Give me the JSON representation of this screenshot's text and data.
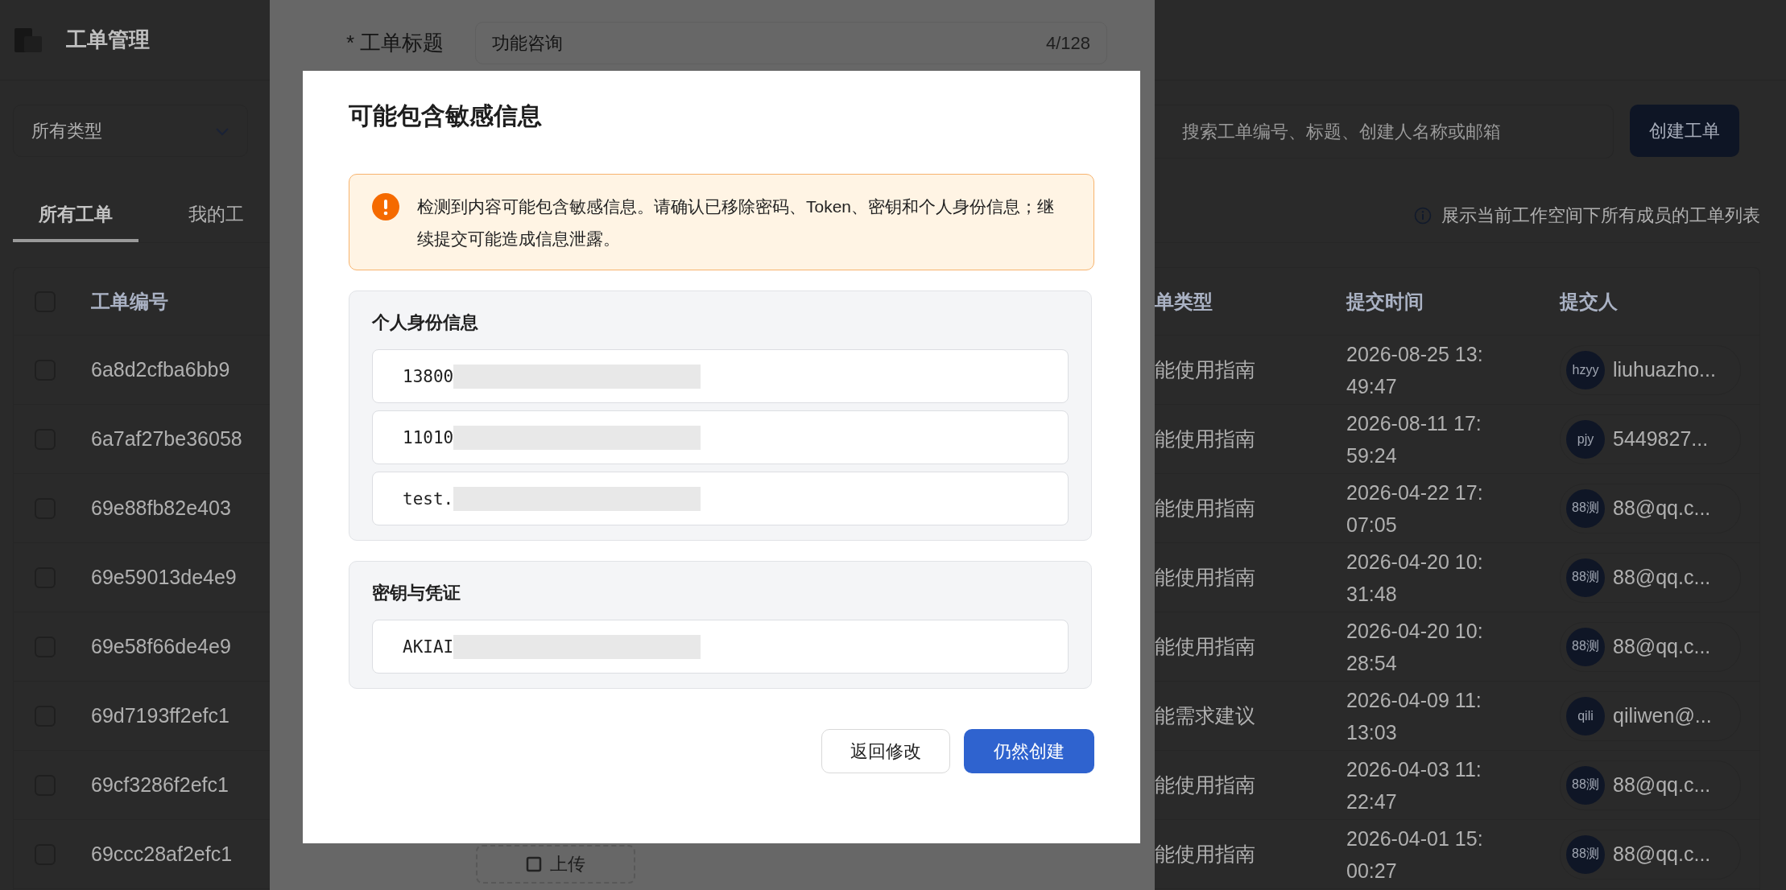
{
  "page": {
    "title": "工单管理",
    "type_filter": {
      "value": "所有类型"
    },
    "search": {
      "placeholder": "搜索工单编号、标题、创建人名称或邮箱"
    },
    "create_button": "创建工单",
    "tabs": [
      {
        "label": "所有工单",
        "selected": true
      },
      {
        "label": "我的工",
        "selected": false
      }
    ],
    "info_text": "展示当前工作空间下所有成员的工单列表",
    "table": {
      "columns": [
        "工单编号",
        "单类型",
        "提交时间",
        "提交人"
      ],
      "header_checked": false,
      "rows": [
        {
          "checked": false,
          "id": "6a8d2cfba6bb9",
          "type": "能使用指南",
          "time": "2026-08-25 13:49:47",
          "avatar": "hzyy",
          "submitter": "liuhuazho..."
        },
        {
          "checked": false,
          "id": "6a7af27be36058",
          "type": "能使用指南",
          "time": "2026-08-11 17:59:24",
          "avatar": "pjy",
          "submitter": "5449827..."
        },
        {
          "checked": false,
          "id": "69e88fb82e403",
          "type": "能使用指南",
          "time": "2026-04-22 17:07:05",
          "avatar": "88测",
          "submitter": "88@qq.c..."
        },
        {
          "checked": false,
          "id": "69e59013de4e9",
          "type": "能使用指南",
          "time": "2026-04-20 10:31:48",
          "avatar": "88测",
          "submitter": "88@qq.c..."
        },
        {
          "checked": false,
          "id": "69e58f66de4e9",
          "type": "能使用指南",
          "time": "2026-04-20 10:28:54",
          "avatar": "88测",
          "submitter": "88@qq.c..."
        },
        {
          "checked": false,
          "id": "69d7193ff2efc1",
          "type": "能需求建议",
          "time": "2026-04-09 11:13:03",
          "avatar": "qili",
          "submitter": "qiliwen@..."
        },
        {
          "checked": false,
          "id": "69cf3286f2efc1",
          "type": "能使用指南",
          "time": "2026-04-03 11:22:47",
          "avatar": "88测",
          "submitter": "88@qq.c..."
        },
        {
          "checked": false,
          "id": "69ccc28af2efc1",
          "type": "能使用指南",
          "time": "2026-04-01 15:00:27",
          "avatar": "88测",
          "submitter": "88@qq.c..."
        }
      ]
    }
  },
  "drawer": {
    "title_label": "* 工单标题",
    "title_value": "功能咨询",
    "char_count": "4/128",
    "upload_label": "上传"
  },
  "dialog": {
    "title": "可能包含敏感信息",
    "alert": {
      "kind": "warning",
      "text": "检测到内容可能包含敏感信息。请确认已移除密码、Token、密钥和个人身份信息；继续提交可能造成信息泄露。"
    },
    "sections": [
      {
        "heading": "个人身份信息",
        "items": [
          {
            "value": "13800",
            "redacted": true
          },
          {
            "value": "11010",
            "redacted": true
          },
          {
            "value": "test.",
            "redacted": true
          }
        ]
      },
      {
        "heading": "密钥与凭证",
        "items": [
          {
            "value": "AKIAI",
            "redacted": true
          }
        ]
      }
    ],
    "buttons": [
      {
        "label": "返回修改",
        "kind": "secondary"
      },
      {
        "label": "仍然创建",
        "kind": "primary"
      }
    ]
  }
}
